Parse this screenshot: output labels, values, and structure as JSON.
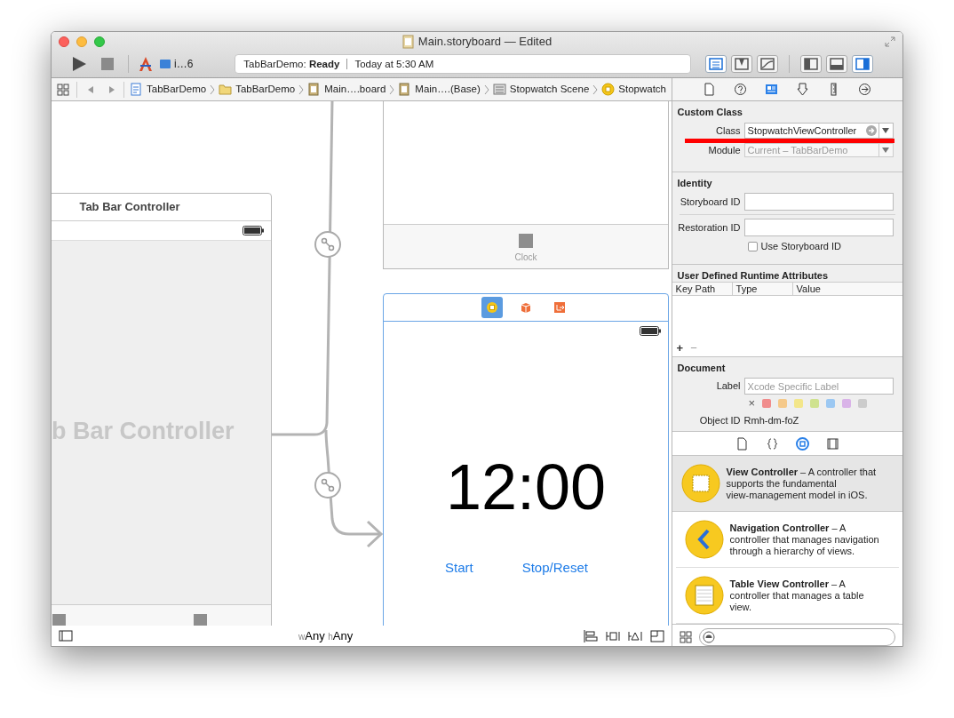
{
  "window": {
    "title": "Main.storyboard — Edited"
  },
  "toolbar": {
    "scheme": "i…6",
    "status_project": "TabBarDemo:",
    "status_state": "Ready",
    "status_time": "Today at 5:30 AM",
    "editor_modes": [
      {
        "kind": "standard",
        "selected": true
      },
      {
        "kind": "assistant",
        "selected": false
      },
      {
        "kind": "version",
        "selected": false
      }
    ],
    "view_toggles": [
      {
        "kind": "navigator",
        "selected": false
      },
      {
        "kind": "debug",
        "selected": false
      },
      {
        "kind": "utilities",
        "selected": true
      }
    ]
  },
  "jump_bar": [
    {
      "kind": "project",
      "label": "TabBarDemo"
    },
    {
      "kind": "folder",
      "label": "TabBarDemo"
    },
    {
      "kind": "storyboard",
      "label": "Main….board"
    },
    {
      "kind": "storyboard",
      "label": "Main….(Base)"
    },
    {
      "kind": "scene",
      "label": "Stopwatch Scene"
    },
    {
      "kind": "controller",
      "label": "Stopwatch"
    }
  ],
  "canvas": {
    "tab_bar_controller": {
      "title": "Tab Bar Controller",
      "placeholder": "b Bar Controller"
    },
    "clock_scene": {
      "tab_label": "Clock"
    },
    "stopwatch_scene": {
      "dock_icons": [
        {
          "kind": "controller",
          "selected": true
        },
        {
          "kind": "responder",
          "selected": false
        },
        {
          "kind": "exit",
          "selected": false
        }
      ],
      "time": "12:00",
      "buttons": [
        "Start",
        "Stop/Reset"
      ]
    }
  },
  "size_class": {
    "width_prefix": "w",
    "width_value": "Any",
    "height_prefix": "h",
    "height_value": "Any"
  },
  "inspector": {
    "tabs": [
      {
        "kind": "file",
        "selected": false
      },
      {
        "kind": "help",
        "selected": false
      },
      {
        "kind": "identity",
        "selected": true
      },
      {
        "kind": "attributes",
        "selected": false
      },
      {
        "kind": "size",
        "selected": false
      },
      {
        "kind": "connections",
        "selected": false
      }
    ],
    "custom_class": {
      "title": "Custom Class",
      "class_label": "Class",
      "class_value": "StopwatchViewController",
      "module_label": "Module",
      "module_placeholder": "Current – TabBarDemo"
    },
    "identity": {
      "title": "Identity",
      "storyboard_id_label": "Storyboard ID",
      "restoration_id_label": "Restoration ID",
      "use_storyboard_id": {
        "label": "Use Storyboard ID",
        "checked": false
      }
    },
    "runtime_attributes": {
      "title": "User Defined Runtime Attributes",
      "columns": [
        "Key Path",
        "Type",
        "Value"
      ],
      "add": "+",
      "remove": "−"
    },
    "document": {
      "title": "Document",
      "label_label": "Label",
      "label_placeholder": "Xcode Specific Label",
      "clear": "×",
      "colors": [
        {
          "color": "#f08c8c"
        },
        {
          "color": "#f5c98a"
        },
        {
          "color": "#f3e68a"
        },
        {
          "color": "#cfe28f"
        },
        {
          "color": "#9cc8f2"
        },
        {
          "color": "#d9b3e8"
        },
        {
          "color": "#cccccc"
        }
      ],
      "object_id_label": "Object ID",
      "object_id": "Rmh-dm-foZ"
    }
  },
  "library": {
    "tabs": [
      {
        "kind": "file",
        "selected": false
      },
      {
        "kind": "code",
        "selected": false
      },
      {
        "kind": "object",
        "selected": true
      },
      {
        "kind": "media",
        "selected": false
      }
    ],
    "items": [
      {
        "kind": "view",
        "text": "**View Controller** – A controller that supports the fundamental view‑management model in iOS.",
        "selected": true
      },
      {
        "kind": "navigation",
        "text": "**Navigation Controller** – A controller that manages navigation through a hierarchy of views.",
        "selected": false
      },
      {
        "kind": "table",
        "text": "**Table View Controller** – A controller that manages a table view.",
        "selected": false
      }
    ]
  }
}
